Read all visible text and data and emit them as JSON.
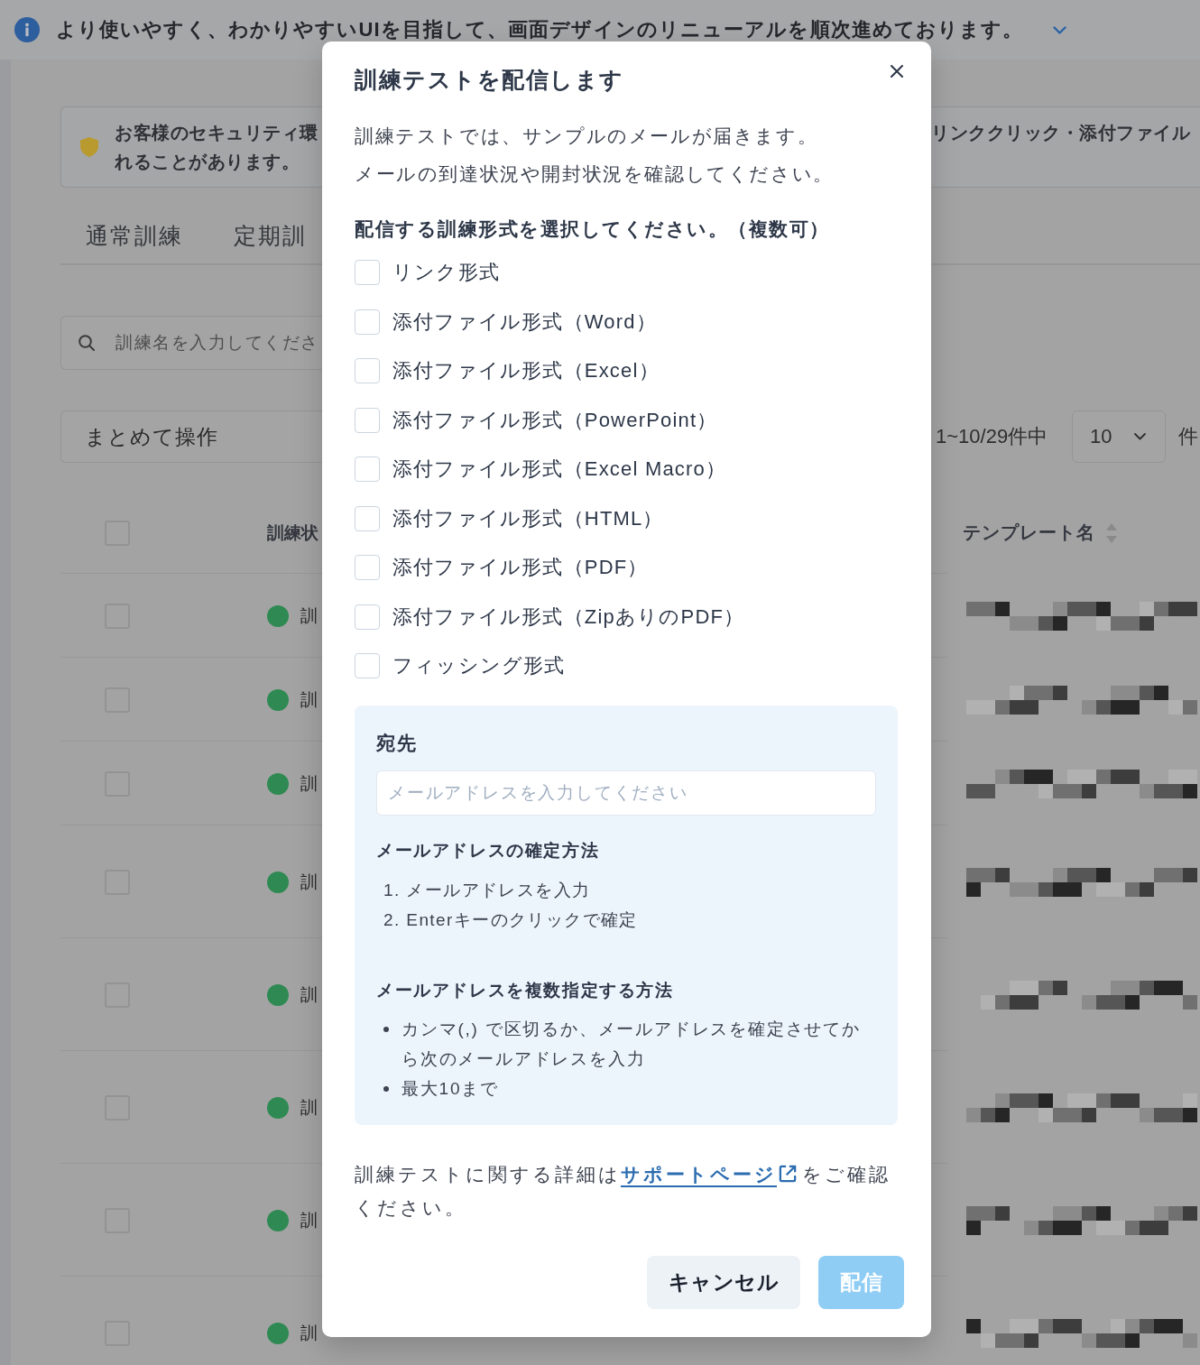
{
  "announcement": {
    "text": "より使いやすく、わかりやすいUIを目指して、画面デザインのリニューアルを順次進めております。"
  },
  "notice": {
    "left_lines": [
      "お客様のセキュリティ環",
      "れることがあります。"
    ],
    "right_lines": [
      "リンククリック・添付ファイル"
    ]
  },
  "tabs": [
    {
      "label": "通常訓練"
    },
    {
      "label": "定期訓"
    }
  ],
  "search": {
    "placeholder": "訓練名を入力してくださ"
  },
  "bulk_action": {
    "value": "まとめて操作"
  },
  "pagination": {
    "range": "1~10/29件中",
    "page_size": "10",
    "unit": "件"
  },
  "table": {
    "header_checked": false,
    "columns": [
      {
        "label": "訓練状"
      },
      {
        "label": "テンプレート名",
        "sortable": true
      }
    ],
    "rows": [
      {
        "checked": false,
        "color": "#2e8a52",
        "status": "訓"
      },
      {
        "checked": false,
        "color": "#2e8a52",
        "status": "訓"
      },
      {
        "checked": false,
        "color": "#2e8a52",
        "status": "訓"
      },
      {
        "checked": false,
        "color": "#2e8a52",
        "status": "訓"
      },
      {
        "checked": false,
        "color": "#2e8a52",
        "status": "訓"
      },
      {
        "checked": false,
        "color": "#2e8a52",
        "status": "訓"
      },
      {
        "checked": false,
        "color": "#2e8a52",
        "status": "訓"
      },
      {
        "checked": false,
        "color": "#2e8a52",
        "status": "訓"
      }
    ]
  },
  "dialog": {
    "title": "訓練テストを配信します",
    "description": [
      "訓練テストでは、サンプルのメールが届きます。",
      "メールの到達状況や開封状況を確認してください。"
    ],
    "format_prompt": "配信する訓練形式を選択してください。（複数可）",
    "formats": [
      {
        "label": "リンク形式",
        "checked": false
      },
      {
        "label": "添付ファイル形式（Word）",
        "checked": false
      },
      {
        "label": "添付ファイル形式（Excel）",
        "checked": false
      },
      {
        "label": "添付ファイル形式（PowerPoint）",
        "checked": false
      },
      {
        "label": "添付ファイル形式（Excel Macro）",
        "checked": false
      },
      {
        "label": "添付ファイル形式（HTML）",
        "checked": false
      },
      {
        "label": "添付ファイル形式（PDF）",
        "checked": false
      },
      {
        "label": "添付ファイル形式（ZipありのPDF）",
        "checked": false
      },
      {
        "label": "フィッシング形式",
        "checked": false
      }
    ],
    "recipient": {
      "label": "宛先",
      "placeholder": "メールアドレスを入力してください",
      "confirm_heading": "メールアドレスの確定方法",
      "confirm_steps": [
        "1. メールアドレスを入力",
        "2. Enterキーのクリックで確定"
      ],
      "multiple_heading": "メールアドレスを複数指定する方法",
      "multiple_notes": [
        "カンマ(,) で区切るか、メールアドレスを確定させてから次のメールアドレスを入力",
        "最大10まで"
      ]
    },
    "footer_note": {
      "before": "訓練テストに関する詳細は",
      "link": "サポートページ",
      "after": "をご確認ください。"
    },
    "buttons": [
      {
        "label": "キャンセル",
        "kind": "secondary",
        "disabled": false
      },
      {
        "label": "配信",
        "kind": "primary",
        "disabled": true
      }
    ]
  }
}
